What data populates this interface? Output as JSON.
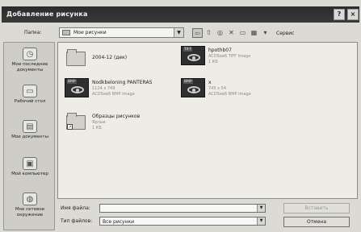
{
  "window": {
    "title": "Добавление рисунка",
    "help_btn": "?",
    "close_btn": "×"
  },
  "toolbar": {
    "lookin_label": "Папка:",
    "lookin_value": "Мои рисунки",
    "service_label": "Сервис"
  },
  "places": [
    {
      "label": "Мои последние документы",
      "icon": "recent-docs-icon"
    },
    {
      "label": "Рабочий стол",
      "icon": "desktop-icon"
    },
    {
      "label": "Мои документы",
      "icon": "my-documents-icon"
    },
    {
      "label": "Мой компьютер",
      "icon": "my-computer-icon"
    },
    {
      "label": "Мое сетевое окружение",
      "icon": "network-icon"
    }
  ],
  "files": [
    {
      "name": "2004-12 (дек)",
      "meta1": "",
      "meta2": "",
      "kind": "folder"
    },
    {
      "name": "hpothb07",
      "meta1": "ACDSee6 TIFF Image",
      "meta2": "1 КБ",
      "kind": "image",
      "tag": "TIFF"
    },
    {
      "name": "Nodkbeloning PANTERAS",
      "meta1": "1124 x 749",
      "meta2": "ACDSee6 BMP Image",
      "kind": "image",
      "tag": "BMP"
    },
    {
      "name": "x",
      "meta1": "745 x 54",
      "meta2": "ACDSee6 BMP Image",
      "kind": "image",
      "tag": "BMP"
    },
    {
      "name": "Образцы рисунков",
      "meta1": "Ярлык",
      "meta2": "1 КБ",
      "kind": "shortcut-folder"
    }
  ],
  "bottom": {
    "filename_label": "Имя файла:",
    "filename_value": "",
    "filetype_label": "Тип файлов:",
    "filetype_value": "Все рисунки",
    "insert_btn": "Вставить",
    "cancel_btn": "Отмена"
  }
}
